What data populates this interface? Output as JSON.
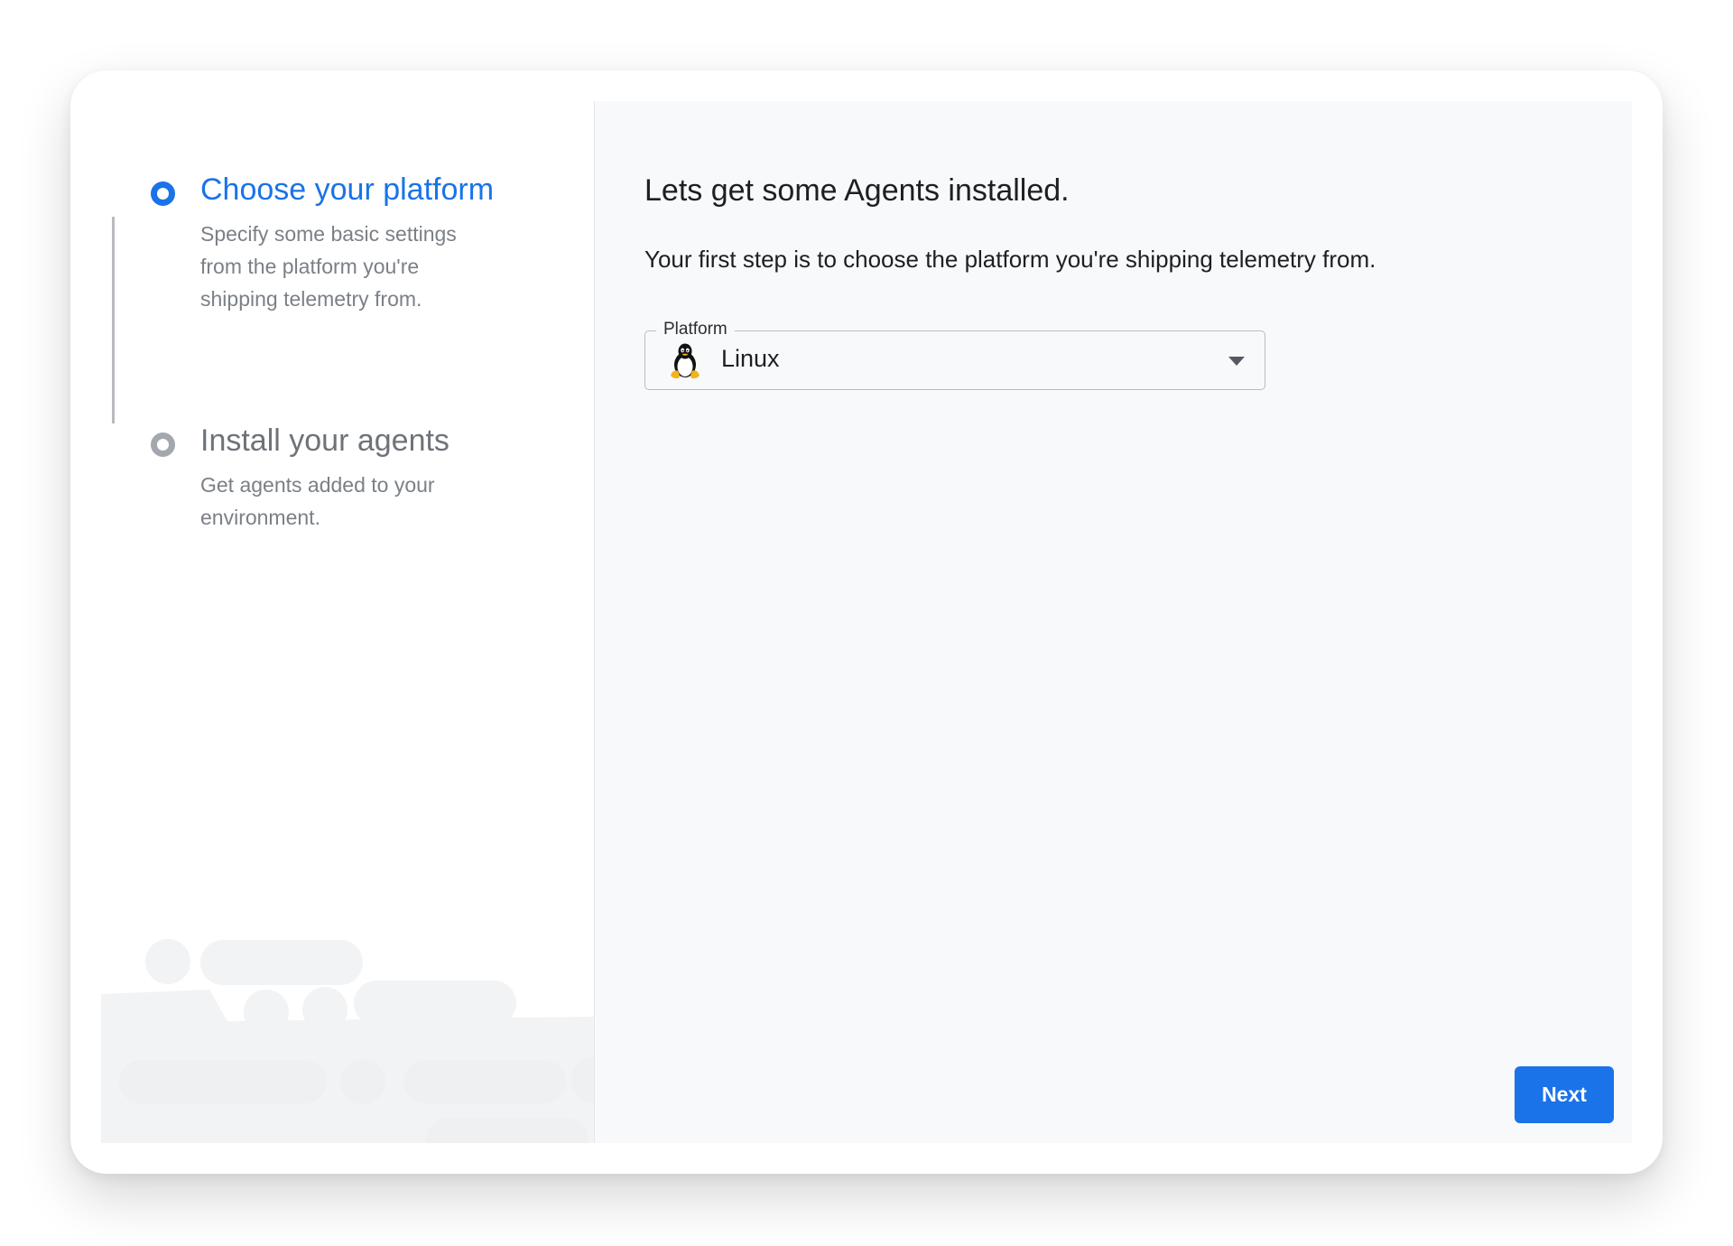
{
  "steps": [
    {
      "title": "Choose your platform",
      "description": "Specify some basic settings from the platform you're shipping telemetry from.",
      "state": "active"
    },
    {
      "title": "Install your agents",
      "description": "Get agents added to your environment.",
      "state": "pending"
    }
  ],
  "main": {
    "heading": "Lets get some Agents installed.",
    "subtext": "Your first step is to choose the platform you're shipping telemetry from.",
    "platform_select": {
      "label": "Platform",
      "value": "Linux",
      "icon": "linux-tux-icon"
    },
    "next_label": "Next"
  },
  "colors": {
    "accent": "#1a73e8",
    "inactive_step": "#a4a8ae",
    "panel_bg": "#f8f9fb"
  }
}
